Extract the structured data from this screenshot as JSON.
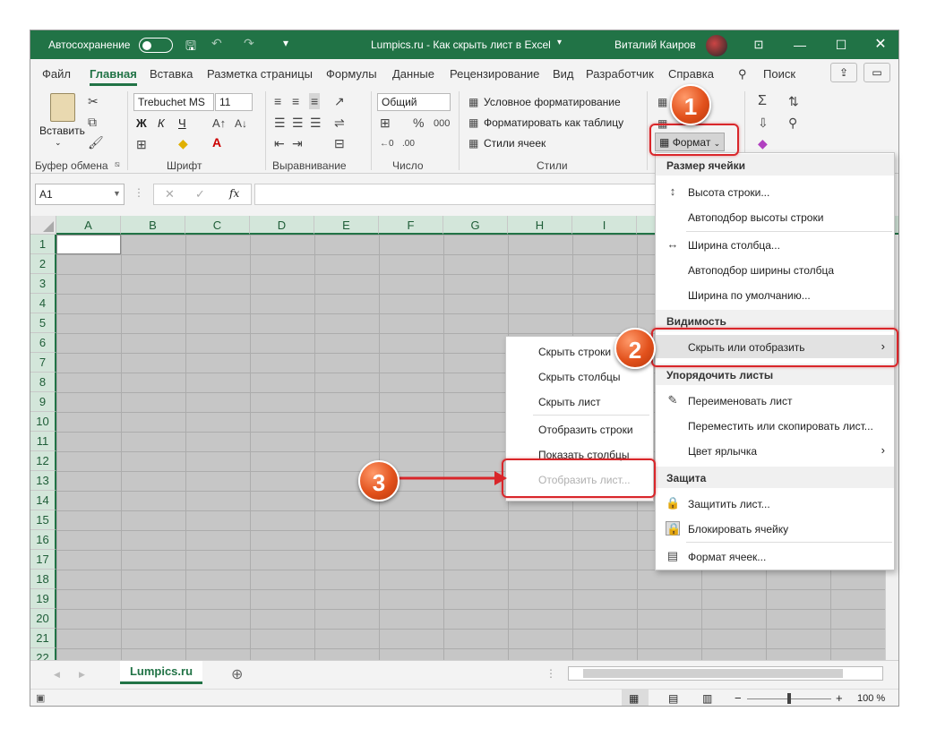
{
  "titlebar": {
    "autosave_label": "Автосохранение",
    "doc_title": "Lumpics.ru - Как скрыть лист в Excel",
    "user_name": "Виталий Каиров"
  },
  "tabs": [
    "Файл",
    "Главная",
    "Вставка",
    "Разметка страницы",
    "Формулы",
    "Данные",
    "Рецензирование",
    "Вид",
    "Разработчик",
    "Справка"
  ],
  "search_label": "Поиск",
  "ribbon": {
    "clipboard": {
      "paste": "Вставить",
      "label": "Буфер обмена"
    },
    "font": {
      "name": "Trebuchet MS",
      "size": "11",
      "bold": "Ж",
      "italic": "К",
      "underline": "Ч",
      "label": "Шрифт"
    },
    "alignment": {
      "label": "Выравнивание"
    },
    "number": {
      "format": "Общий",
      "label": "Число"
    },
    "styles": {
      "conditional": "Условное форматирование",
      "table": "Форматировать как таблицу",
      "cell_styles": "Стили ячеек",
      "label": "Стили"
    },
    "cells": {
      "format": "Формат"
    }
  },
  "formula_bar": {
    "name_box": "A1",
    "fx": "fx"
  },
  "columns": [
    "A",
    "B",
    "C",
    "D",
    "E",
    "F",
    "G",
    "H",
    "I"
  ],
  "rows": [
    "1",
    "2",
    "3",
    "4",
    "5",
    "6",
    "7",
    "8",
    "9",
    "10",
    "11",
    "12",
    "13",
    "14",
    "15",
    "16",
    "17",
    "18",
    "19",
    "20",
    "21",
    "22"
  ],
  "format_menu": {
    "cell_size_header": "Размер ячейки",
    "row_height": "Высота строки...",
    "autofit_row": "Автоподбор высоты строки",
    "col_width": "Ширина столбца...",
    "autofit_col": "Автоподбор ширины столбца",
    "default_width": "Ширина по умолчанию...",
    "visibility_header": "Видимость",
    "hide_unhide": "Скрыть или отобразить",
    "organize_header": "Упорядочить листы",
    "rename": "Переименовать лист",
    "move_copy": "Переместить или скопировать лист...",
    "tab_color": "Цвет ярлычка",
    "protection_header": "Защита",
    "protect": "Защитить лист...",
    "lock_cell": "Блокировать ячейку",
    "format_cells": "Формат ячеек..."
  },
  "submenu": {
    "hide_rows": "Скрыть строки",
    "hide_cols": "Скрыть столбцы",
    "hide_sheet": "Скрыть лист",
    "show_rows": "Отобразить строки",
    "show_cols": "Показать столбцы",
    "show_sheet": "Отобразить лист..."
  },
  "badges": [
    "1",
    "2",
    "3"
  ],
  "sheet_tab": "Lumpics.ru",
  "zoom": "100 %",
  "colors": {
    "accent": "#217346",
    "badge": "#e2511c",
    "highlight": "#d9262a"
  }
}
